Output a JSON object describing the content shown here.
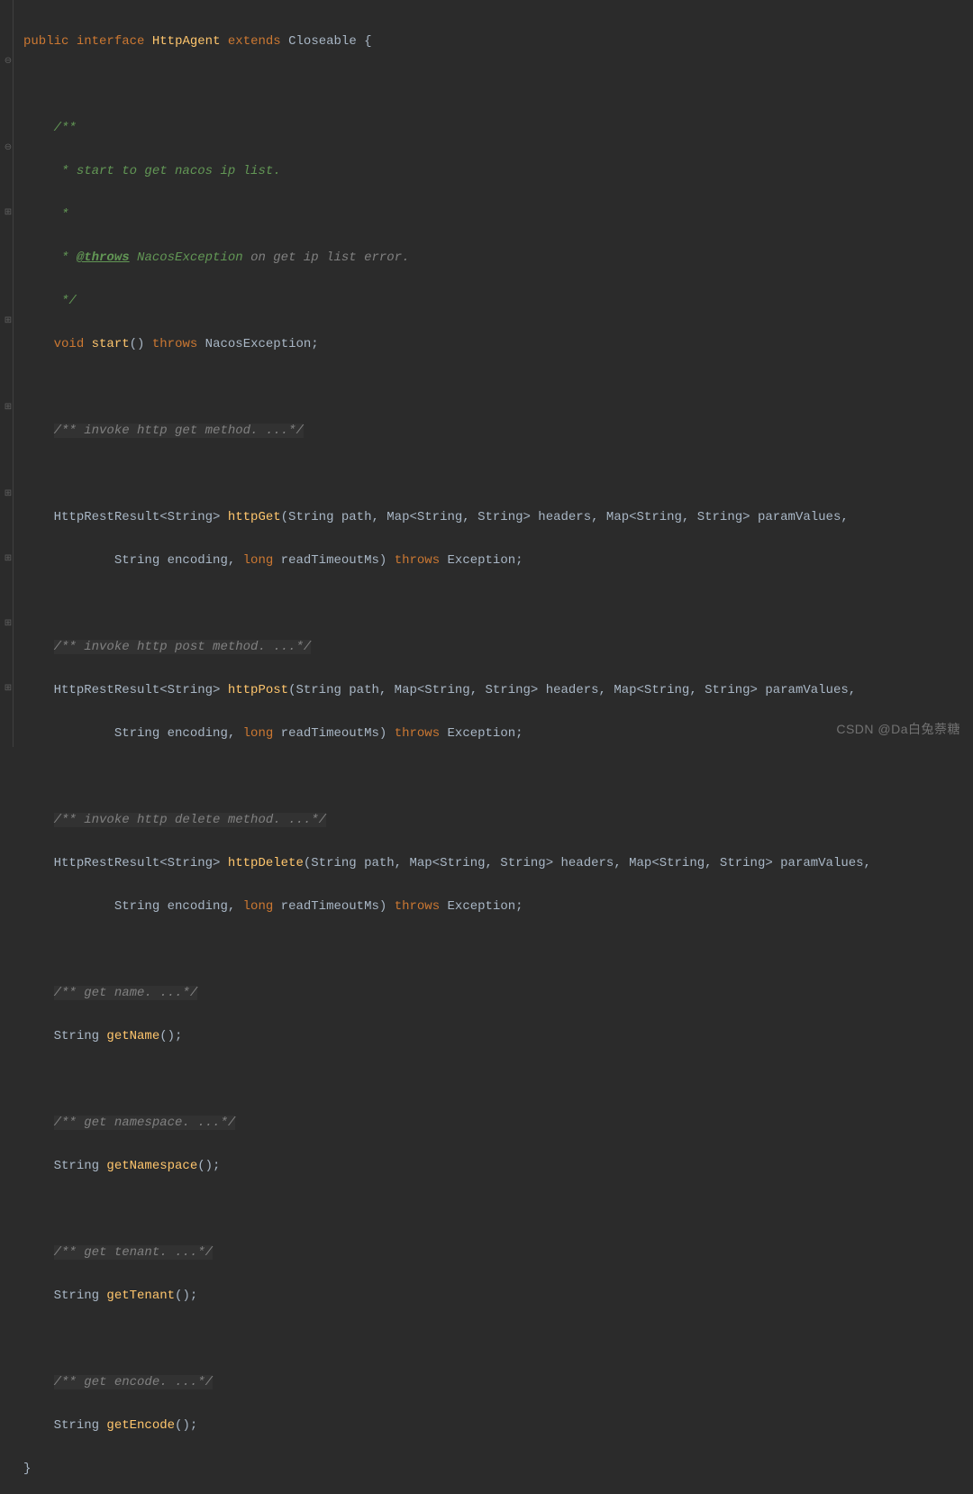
{
  "code": {
    "l1_kw1": "public",
    "l1_kw2": "interface",
    "l1_name": "HttpAgent",
    "l1_kw3": "extends",
    "l1_parent": "Closeable",
    "l1_brace": " {",
    "doc_open": "/**",
    "doc_l1": " * start to get nacos ip list.",
    "doc_l2": " *",
    "doc_l3_pre": " * ",
    "doc_tag": "@throws",
    "doc_l3_mid": " NacosException",
    "doc_l3_post": " on get ip list error.",
    "doc_close": " */",
    "m1_kw": "void",
    "m1_name": "start",
    "m1_parens": "()",
    "m1_throws": "throws",
    "m1_exc": " NacosException;",
    "c_get": "/** invoke http get method. ...*/",
    "ret_pre": "HttpRestResult<String> ",
    "m_get": "httpGet",
    "sig_a": "(String path, Map<String, String> headers, Map<String, String> paramValues,",
    "sig_b_pre": "        String encoding, ",
    "kw_long": "long",
    "sig_b_mid": " readTimeoutMs) ",
    "kw_throws": "throws",
    "sig_b_post": " Exception;",
    "c_post": "/** invoke http post method. ...*/",
    "m_post": "httpPost",
    "c_del": "/** invoke http delete method. ...*/",
    "m_del": "httpDelete",
    "c_name": "/** get name. ...*/",
    "m_getname": "getName",
    "empty_parens_semi": "();",
    "ret_str": "String ",
    "c_ns": "/** get namespace. ...*/",
    "m_getns": "getNamespace",
    "c_tenant": "/** get tenant. ...*/",
    "m_gettenant": "getTenant",
    "c_encode": "/** get encode. ...*/",
    "m_getencode": "getEncode",
    "close_brace": "}"
  },
  "watermark": "CSDN @Da白兔萘糖"
}
